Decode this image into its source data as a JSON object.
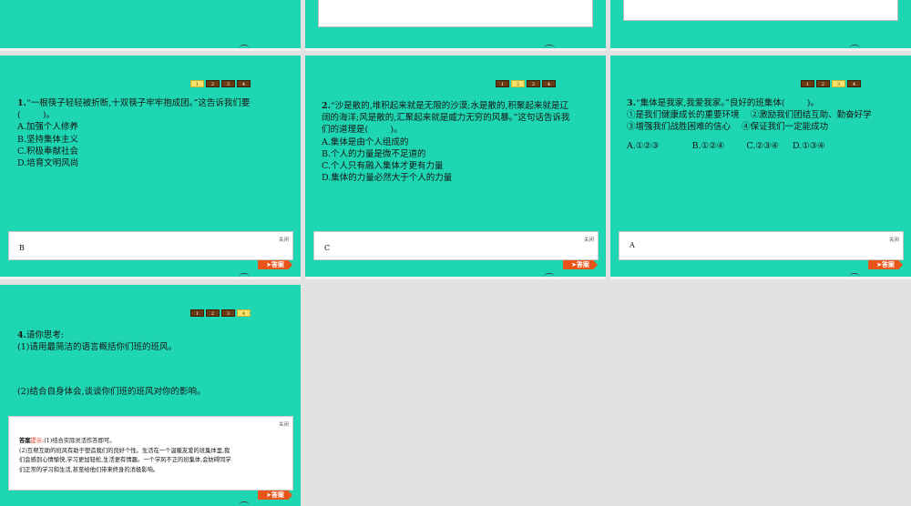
{
  "nav_labels": [
    "1",
    "2",
    "3",
    "4"
  ],
  "close_label": "关闭",
  "answer_button": "➤答案",
  "q1": {
    "number": "1.",
    "lines": [
      "“一根筷子轻轻被折断,十双筷子牢牢抱成团。”这告诉我们要",
      "(        )。"
    ],
    "options": [
      "A.加强个人修养",
      "B.坚持集体主义",
      "C.积极奉献社会",
      "D.培育文明风尚"
    ],
    "answer": "B"
  },
  "q2": {
    "number": "2.",
    "lines": [
      "“沙是散的,堆积起来就是无限的沙漠;水是散的,积聚起来就是辽",
      "阔的海洋;风是散的,汇聚起来就是威力无穷的风暴。”这句话告诉我",
      "们的道理是(        )。"
    ],
    "options": [
      "A.集体是由个人组成的",
      "B.个人的力量是微不足道的",
      "C.个人只有融入集体才更有力量",
      "D.集体的力量必然大于个人的力量"
    ],
    "answer": "C"
  },
  "q3": {
    "number": "3.",
    "lines": [
      "“集体是我家,我爱我家。”良好的班集体(        )。",
      "①是我们健康成长的重要环境    ②激励我们团结互助、勤奋好学",
      "③增强我们战胜困难的信心    ④保证我们一定能成功"
    ],
    "options_line": "A.①②③            B.①②④        C.②③④     D.①③④",
    "answer": "A"
  },
  "q4": {
    "number": "4.",
    "title": "请你思考:",
    "sub1": "(1)请用最简洁的语言概括你们班的班风。",
    "sub2": "(2)结合自身体会,谈谈你们班的班风对你的影响。",
    "answer_prefix": "答案",
    "hint_label": "提示:",
    "answer_line1": "(1)结合实际灵活作答即可。",
    "answer_lines": [
      "(2)互帮互助的班风有助于塑造我们的良好个性。生活在一个温暖友爱的班集体里,我",
      "们会感到心情愉快,学习更加轻松,生活更有情趣。一个学风不正的班集体,会妨碍同学",
      "们正常的学习和生活,甚至给他们带来终身的消极影响。"
    ]
  }
}
